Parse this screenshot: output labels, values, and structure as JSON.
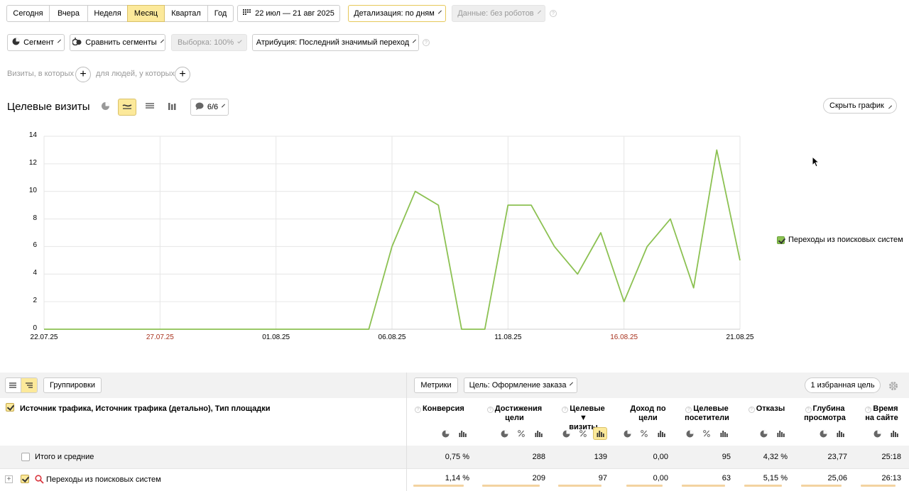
{
  "period": {
    "tabs": [
      "Сегодня",
      "Вчера",
      "Неделя",
      "Месяц",
      "Квартал",
      "Год"
    ],
    "active": "Месяц",
    "date_range": "22 июл — 21 авг 2025",
    "detail": "Детализация: по дням",
    "data_filter": "Данные: без роботов"
  },
  "segment": {
    "segment_label": "Сегмент",
    "compare_label": "Сравнить сегменты",
    "sample_label": "Выборка: 100%",
    "attribution_label": "Атрибуция: Последний значимый переход",
    "visits_label": "Визиты, в которых",
    "people_label": "для людей, у которых"
  },
  "chart_header": {
    "title": "Целевые визиты",
    "series_count": "6/6",
    "hide_chart": "Скрыть график"
  },
  "chart_data": {
    "type": "line",
    "title": "Целевые визиты",
    "ylim": [
      0,
      14
    ],
    "yticks": [
      "0",
      "2",
      "4",
      "6",
      "8",
      "10",
      "12",
      "14"
    ],
    "x_tick_labels": [
      {
        "label": "22.07.25",
        "weekend": false
      },
      {
        "label": "27.07.25",
        "weekend": true
      },
      {
        "label": "01.08.25",
        "weekend": false
      },
      {
        "label": "06.08.25",
        "weekend": false
      },
      {
        "label": "11.08.25",
        "weekend": false
      },
      {
        "label": "16.08.25",
        "weekend": true
      },
      {
        "label": "21.08.25",
        "weekend": false
      }
    ],
    "x": [
      "22.07.25",
      "23.07.25",
      "24.07.25",
      "25.07.25",
      "26.07.25",
      "27.07.25",
      "28.07.25",
      "29.07.25",
      "30.07.25",
      "31.07.25",
      "01.08.25",
      "02.08.25",
      "03.08.25",
      "04.08.25",
      "05.08.25",
      "06.08.25",
      "07.08.25",
      "08.08.25",
      "09.08.25",
      "10.08.25",
      "11.08.25",
      "12.08.25",
      "13.08.25",
      "14.08.25",
      "15.08.25",
      "16.08.25",
      "17.08.25",
      "18.08.25",
      "19.08.25",
      "20.08.25",
      "21.08.25"
    ],
    "series": [
      {
        "name": "Переходы из поисковых систем",
        "color": "#8cc152",
        "values": [
          0,
          0,
          0,
          0,
          0,
          0,
          0,
          0,
          0,
          0,
          0,
          0,
          0,
          0,
          0,
          6,
          10,
          9,
          0,
          0,
          9,
          9,
          6,
          4,
          7,
          2,
          6,
          8,
          3,
          13,
          5
        ]
      }
    ],
    "grid": true,
    "legend": "right"
  },
  "table": {
    "view_icons": [
      "list-icon",
      "tree-icon"
    ],
    "groupings_label": "Группировки",
    "metrics_label": "Метрики",
    "goal_label": "Цель: Оформление заказа",
    "favorite_goal": "1 избранная цель",
    "dimension_header": "Источник трафика, Источник трафика (детально), Тип площадки",
    "columns": [
      {
        "line1": "Конверсия",
        "line2": ""
      },
      {
        "line1": "Достижения",
        "line2": "цели"
      },
      {
        "line1": "Целевые ▼",
        "line2": "визиты"
      },
      {
        "line1": "Доход по",
        "line2": "цели"
      },
      {
        "line1": "Целевые",
        "line2": "посетители"
      },
      {
        "line1": "Отказы",
        "line2": ""
      },
      {
        "line1": "Глубина",
        "line2": "просмотра"
      },
      {
        "line1": "Время",
        "line2": "на сайте"
      }
    ],
    "total": {
      "label": "Итого и средние",
      "values": [
        "0,75 %",
        "288",
        "139",
        "0,00",
        "95",
        "4,32 %",
        "23,77",
        "25:18"
      ]
    },
    "rows": [
      {
        "label": "Переходы из поисковых систем",
        "values": [
          "1,14 %",
          "209",
          "97",
          "0,00",
          "63",
          "5,15 %",
          "25,06",
          "26:13"
        ]
      }
    ]
  }
}
